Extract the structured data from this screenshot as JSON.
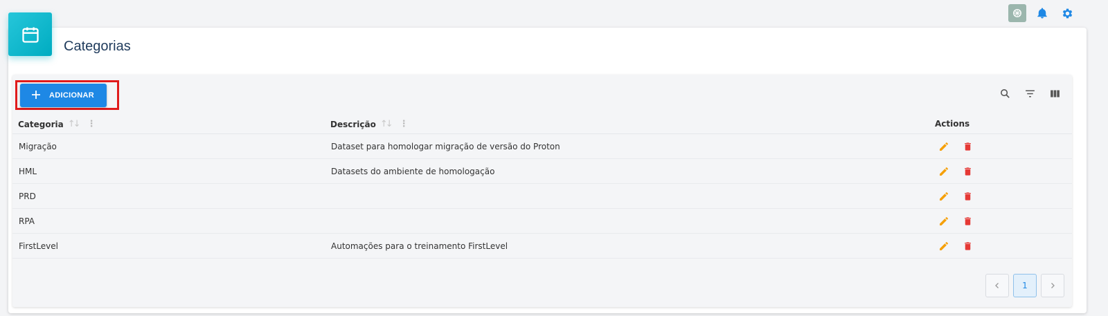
{
  "header": {
    "icons": [
      "chatgpt-icon",
      "bell-icon",
      "gear-icon"
    ],
    "colors": {
      "accent": "#1e88e5",
      "badge": "#00acc1"
    }
  },
  "page": {
    "title": "Categorias",
    "badge_icon": "calendar-icon"
  },
  "toolbar": {
    "add_label": "ADICIONAR",
    "right_icons": [
      "search-icon",
      "filter-icon",
      "columns-icon"
    ]
  },
  "table": {
    "columns": [
      {
        "label": "Categoria"
      },
      {
        "label": "Descrição"
      },
      {
        "label": "Actions"
      }
    ],
    "rows": [
      {
        "categoria": "Migração",
        "descricao": "Dataset para homologar migração de versão do Proton"
      },
      {
        "categoria": "HML",
        "descricao": "Datasets do ambiente de homologação"
      },
      {
        "categoria": "PRD",
        "descricao": ""
      },
      {
        "categoria": "RPA",
        "descricao": ""
      },
      {
        "categoria": "FirstLevel",
        "descricao": "Automações para o treinamento FirstLevel"
      }
    ],
    "action_icons": [
      "edit-icon",
      "delete-icon"
    ],
    "action_colors": {
      "edit": "#f5a00a",
      "delete": "#e53935"
    }
  },
  "pagination": {
    "current": "1"
  }
}
